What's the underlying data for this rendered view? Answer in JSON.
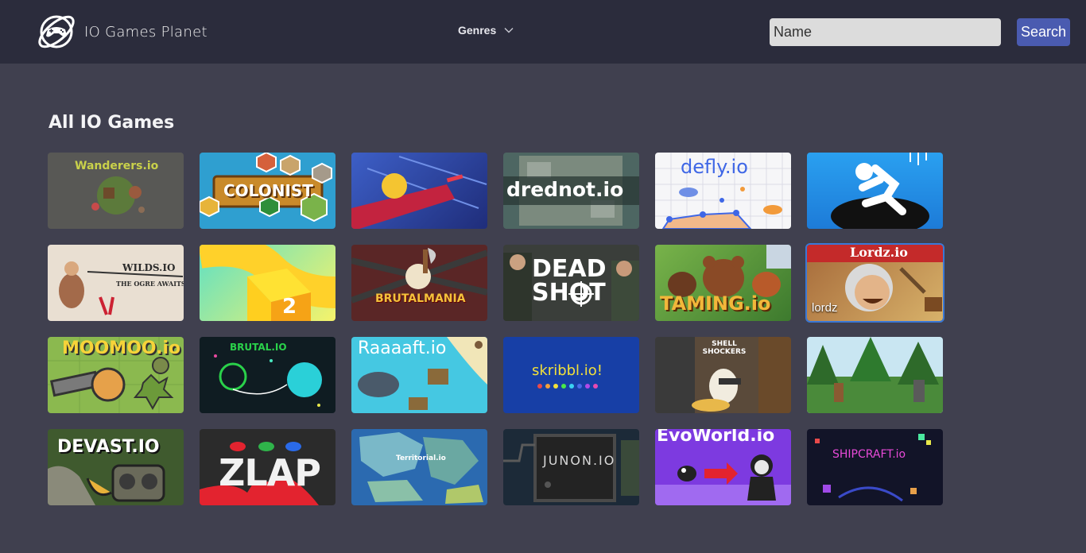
{
  "header": {
    "brand": "IO Games Planet",
    "genres_label": "Genres",
    "search_placeholder": "Name",
    "search_button": "Search"
  },
  "main": {
    "title": "All IO Games"
  },
  "games": [
    {
      "name": "wanderers",
      "art": "Wanderers.io"
    },
    {
      "name": "colonist",
      "art": "COLONIST"
    },
    {
      "name": "ball-runner",
      "art": ""
    },
    {
      "name": "drednot",
      "art": "drednot.io"
    },
    {
      "name": "defly",
      "art": "defly.io"
    },
    {
      "name": "hole-jump",
      "art": ""
    },
    {
      "name": "wilds",
      "art": "WILDS.IO"
    },
    {
      "name": "cube-run",
      "art": ""
    },
    {
      "name": "brutalmania",
      "art": "BRUTALMANIA"
    },
    {
      "name": "deadshot",
      "art": "DEAD SHOT"
    },
    {
      "name": "taming",
      "art": "TAMING.io"
    },
    {
      "name": "lordz",
      "art": "Lordz.io",
      "label": "lordz"
    },
    {
      "name": "moomoo",
      "art": "MOOMOO.io"
    },
    {
      "name": "brutal",
      "art": "BRUTAL.IO"
    },
    {
      "name": "raaaaft",
      "art": "Raaaaft.io"
    },
    {
      "name": "skribbl",
      "art": "skribbl.io!"
    },
    {
      "name": "shell-shockers",
      "art": "SHELL SHOCKERS"
    },
    {
      "name": "forest-archers",
      "art": ""
    },
    {
      "name": "devast",
      "art": "DEVAST.IO"
    },
    {
      "name": "zlap",
      "art": "ZLAP"
    },
    {
      "name": "territorial",
      "art": "Territorial.io"
    },
    {
      "name": "junon",
      "art": "JUNON.IO"
    },
    {
      "name": "evoworld",
      "art": "EvoWorld.io"
    },
    {
      "name": "shipcraft",
      "art": "SHIPCRAFT.io"
    }
  ],
  "colors": {
    "page_bg": "#40404f",
    "navbar_bg": "#2b2c3c",
    "search_button_bg": "#4a5bb0",
    "hover_outline": "#3a78d6"
  },
  "icons": {
    "logo": "planet-gamepad-icon",
    "dropdown": "chevron-down-icon"
  }
}
